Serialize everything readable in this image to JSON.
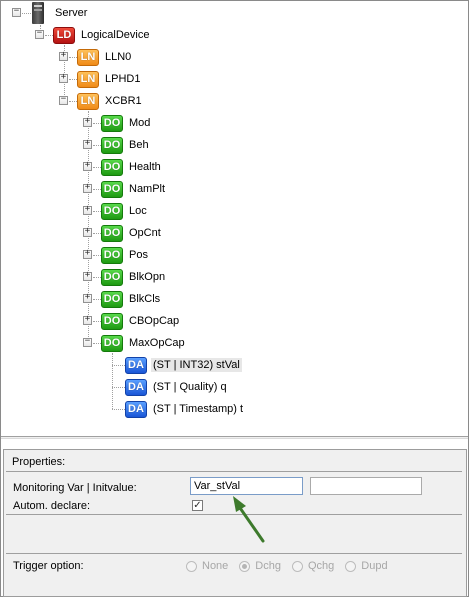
{
  "tree": {
    "server": {
      "label": "Server",
      "icon": "server-icon"
    },
    "logical_device": {
      "badge": "LD",
      "label": "LogicalDevice"
    },
    "logical_nodes": [
      {
        "badge": "LN",
        "label": "LLN0",
        "expander": "+"
      },
      {
        "badge": "LN",
        "label": "LPHD1",
        "expander": "+"
      },
      {
        "badge": "LN",
        "label": "XCBR1",
        "expander": "−"
      }
    ],
    "data_objects": [
      {
        "badge": "DO",
        "label": "Mod",
        "expander": "+"
      },
      {
        "badge": "DO",
        "label": "Beh",
        "expander": "+"
      },
      {
        "badge": "DO",
        "label": "Health",
        "expander": "+"
      },
      {
        "badge": "DO",
        "label": "NamPlt",
        "expander": "+"
      },
      {
        "badge": "DO",
        "label": "Loc",
        "expander": "+"
      },
      {
        "badge": "DO",
        "label": "OpCnt",
        "expander": "+"
      },
      {
        "badge": "DO",
        "label": "Pos",
        "expander": "+"
      },
      {
        "badge": "DO",
        "label": "BlkOpn",
        "expander": "+"
      },
      {
        "badge": "DO",
        "label": "BlkCls",
        "expander": "+"
      },
      {
        "badge": "DO",
        "label": "CBOpCap",
        "expander": "+"
      },
      {
        "badge": "DO",
        "label": "MaxOpCap",
        "expander": "−"
      }
    ],
    "data_attributes": [
      {
        "badge": "DA",
        "label": "(ST | INT32)  stVal",
        "selected": true
      },
      {
        "badge": "DA",
        "label": "(ST | Quality)  q",
        "selected": false
      },
      {
        "badge": "DA",
        "label": "(ST | Timestamp)  t",
        "selected": false
      }
    ]
  },
  "properties": {
    "title": "Properties:",
    "monitoring_label": "Monitoring Var | Initvalue:",
    "monitoring_value": "Var_stVal",
    "init_value": "",
    "autom_declare_label": "Autom. declare:",
    "autom_declare_checked": "✓",
    "trigger_label": "Trigger option:",
    "trigger_options": [
      "None",
      "Dchg",
      "Qchg",
      "Dupd"
    ],
    "trigger_selected": "Dchg"
  },
  "colors": {
    "LD": "#c8201a",
    "LN": "#f29a2a",
    "DO": "#27a81a",
    "DA": "#1f5fe0",
    "arrow": "#3d7a2c"
  }
}
